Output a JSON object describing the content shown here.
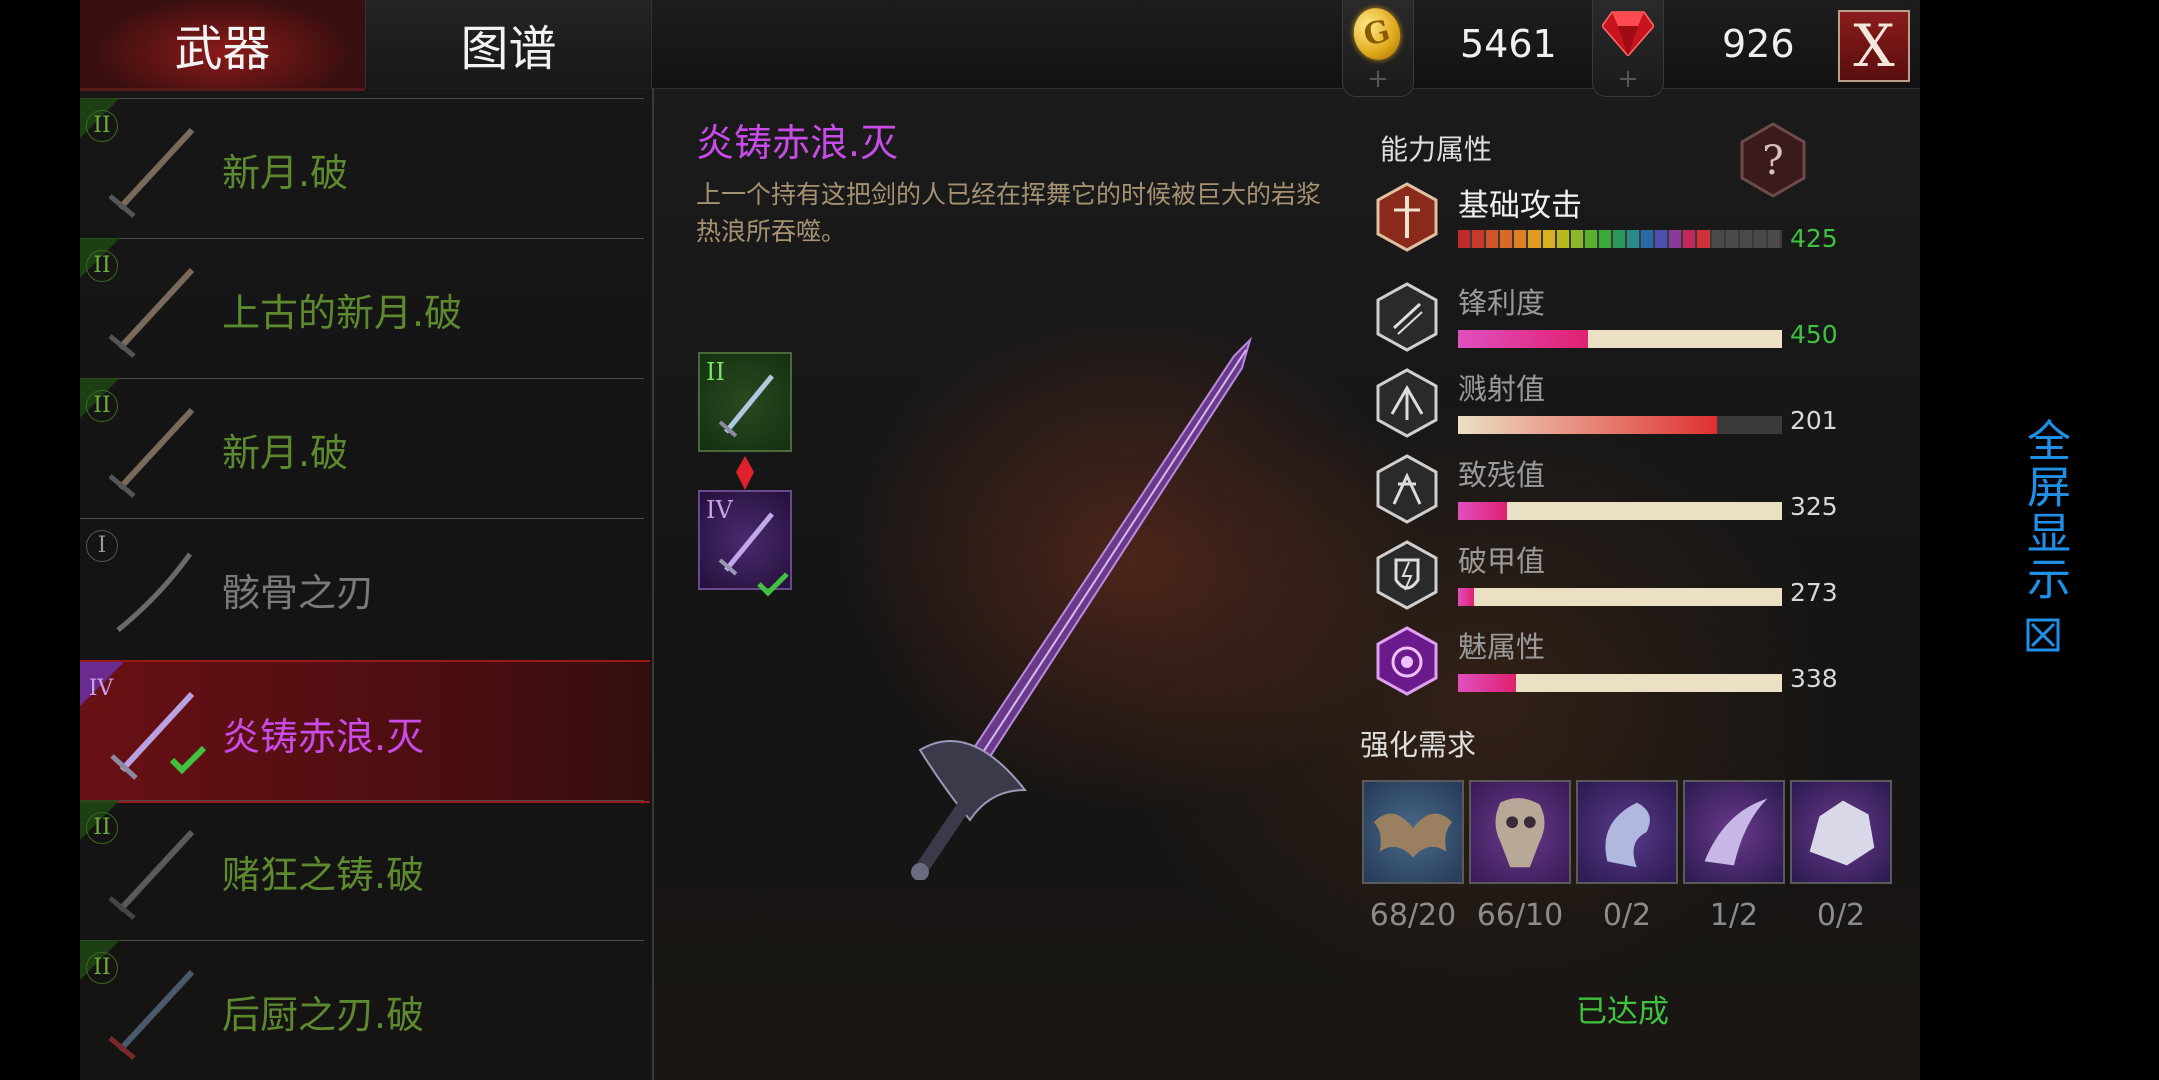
{
  "tabs": {
    "weapons": "武器",
    "atlas": "图谱"
  },
  "currency": {
    "gold": "5461",
    "gems": "926",
    "plus": "+"
  },
  "close_label": "X",
  "weapons": [
    {
      "tier": "II",
      "name": "新月.破",
      "color": "green"
    },
    {
      "tier": "II",
      "name": "上古的新月.破",
      "color": "green"
    },
    {
      "tier": "II",
      "name": "新月.破",
      "color": "green"
    },
    {
      "tier": "I",
      "name": "骸骨之刃",
      "color": "grey"
    },
    {
      "tier": "IV",
      "name": "炎铸赤浪.灭",
      "color": "purple",
      "selected": true,
      "equipped": true
    },
    {
      "tier": "II",
      "name": "赌狂之铸.破",
      "color": "green"
    },
    {
      "tier": "II",
      "name": "后厨之刃.破",
      "color": "green"
    }
  ],
  "detail": {
    "title": "炎铸赤浪.灭",
    "description": "上一个持有这把剑的人已经在挥舞它的时候被巨大的岩浆热浪所吞噬。",
    "upgrade_slots": [
      {
        "tier": "II"
      },
      {
        "tier": "IV"
      }
    ]
  },
  "stats": {
    "title": "能力属性",
    "help": "?",
    "items": [
      {
        "label": "基础攻击",
        "value": "425",
        "icon": "attack-icon"
      },
      {
        "label": "锋利度",
        "value": "450",
        "icon": "sharpness-icon",
        "level": 0.4
      },
      {
        "label": "溅射值",
        "value": "201",
        "icon": "splash-icon",
        "level": 0.8
      },
      {
        "label": "致残值",
        "value": "325",
        "icon": "cripple-icon",
        "level": 0.15
      },
      {
        "label": "破甲值",
        "value": "273",
        "icon": "armor-break-icon",
        "level": 0.05
      },
      {
        "label": "魅属性",
        "value": "338",
        "icon": "charm-icon",
        "level": 0.18
      }
    ]
  },
  "requirements": {
    "title": "强化需求",
    "items": [
      {
        "name": "bat-wing-material",
        "count": "68/20"
      },
      {
        "name": "beast-skull-material",
        "count": "66/10"
      },
      {
        "name": "claw-material",
        "count": "0/2"
      },
      {
        "name": "scythe-blade-material",
        "count": "1/2"
      },
      {
        "name": "ore-material",
        "count": "0/2"
      }
    ],
    "status": "已达成"
  },
  "fullscreen_label": "全屏显示",
  "colors": {
    "accent_red": "#9a1a1a",
    "rarity_purple": "#c94be8",
    "rarity_green": "#5d8a2e",
    "ok_green": "#3fc23f",
    "link_blue": "#1e90e8"
  }
}
